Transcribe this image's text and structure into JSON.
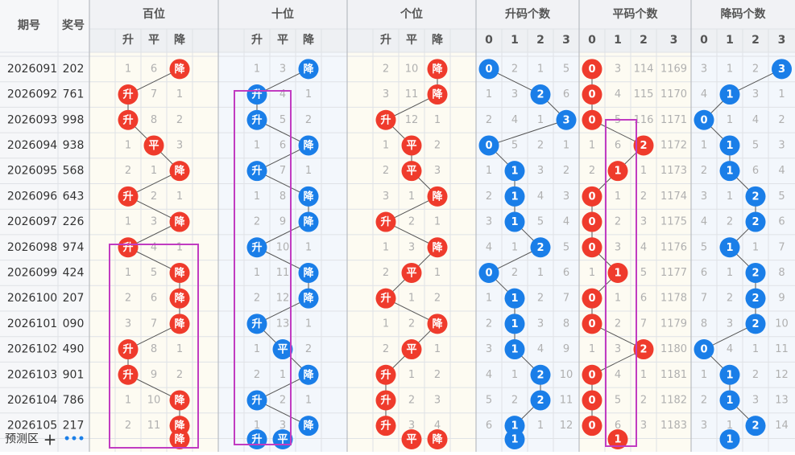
{
  "header": {
    "period_label": "期号",
    "prize_label": "奖号",
    "groups": [
      "百位",
      "十位",
      "个位",
      "升码个数",
      "平码个数",
      "降码个数"
    ],
    "trend_subs": [
      "升",
      "平",
      "降"
    ],
    "count_subs": [
      "0",
      "1",
      "2",
      "3"
    ]
  },
  "footer": {
    "label": "预测区",
    "plus": "+",
    "more": "•••"
  },
  "colors": {
    "red": "#ef3b2c",
    "blue": "#1a7ee8",
    "highlight": "#c13cc1",
    "miss": "#b0b0b0"
  },
  "chart_data": {
    "type": "table",
    "rows": [
      {
        "period": "2026091",
        "number": "202",
        "hundreds": "降",
        "tens": "降",
        "units": "降",
        "up_hit": 0,
        "flat_hit": 0,
        "down_hit": 3,
        "misses": [
          [
            "1",
            "6",
            ""
          ],
          [
            "1",
            "3",
            ""
          ],
          [
            "2",
            "10",
            ""
          ],
          [
            "",
            "2",
            "1",
            "5"
          ],
          [
            "",
            "3",
            "114",
            "1169"
          ],
          [
            "3",
            "1",
            "2",
            ""
          ]
        ]
      },
      {
        "period": "2026092",
        "number": "761",
        "hundreds": "升",
        "tens": "升",
        "units": "降",
        "up_hit": 2,
        "flat_hit": 0,
        "down_hit": 1,
        "misses": [
          [
            "",
            "7",
            "1"
          ],
          [
            "",
            "4",
            "1"
          ],
          [
            "3",
            "11",
            ""
          ],
          [
            "1",
            "3",
            "",
            "6"
          ],
          [
            "",
            "4",
            "115",
            "1170"
          ],
          [
            "4",
            "",
            "3",
            "1"
          ]
        ]
      },
      {
        "period": "2026093",
        "number": "998",
        "hundreds": "升",
        "tens": "升",
        "units": "升",
        "up_hit": 3,
        "flat_hit": 0,
        "down_hit": 0,
        "misses": [
          [
            "",
            "8",
            "2"
          ],
          [
            "",
            "5",
            "2"
          ],
          [
            "",
            "12",
            "1"
          ],
          [
            "2",
            "4",
            "1",
            ""
          ],
          [
            "",
            "5",
            "116",
            "1171"
          ],
          [
            "",
            "1",
            "4",
            "2"
          ]
        ]
      },
      {
        "period": "2026094",
        "number": "938",
        "hundreds": "平",
        "tens": "降",
        "units": "平",
        "up_hit": 0,
        "flat_hit": 2,
        "down_hit": 1,
        "misses": [
          [
            "1",
            "",
            "3"
          ],
          [
            "1",
            "6",
            ""
          ],
          [
            "1",
            "",
            "2"
          ],
          [
            "",
            "5",
            "2",
            "1"
          ],
          [
            "1",
            "6",
            "",
            "1172"
          ],
          [
            "1",
            "",
            "5",
            "3"
          ]
        ]
      },
      {
        "period": "2026095",
        "number": "568",
        "hundreds": "降",
        "tens": "升",
        "units": "平",
        "up_hit": 1,
        "flat_hit": 1,
        "down_hit": 1,
        "misses": [
          [
            "2",
            "1",
            ""
          ],
          [
            "",
            "7",
            "1"
          ],
          [
            "2",
            "",
            "3"
          ],
          [
            "1",
            "",
            "3",
            "2"
          ],
          [
            "2",
            "",
            "1",
            "1173"
          ],
          [
            "2",
            "",
            "6",
            "4"
          ]
        ]
      },
      {
        "period": "2026096",
        "number": "643",
        "hundreds": "升",
        "tens": "降",
        "units": "降",
        "up_hit": 1,
        "flat_hit": 0,
        "down_hit": 2,
        "misses": [
          [
            "",
            "2",
            "1"
          ],
          [
            "1",
            "8",
            ""
          ],
          [
            "3",
            "1",
            ""
          ],
          [
            "2",
            "",
            "4",
            "3"
          ],
          [
            "",
            "1",
            "2",
            "1174"
          ],
          [
            "3",
            "1",
            "",
            "5"
          ]
        ]
      },
      {
        "period": "2026097",
        "number": "226",
        "hundreds": "降",
        "tens": "降",
        "units": "升",
        "up_hit": 1,
        "flat_hit": 0,
        "down_hit": 2,
        "misses": [
          [
            "1",
            "3",
            ""
          ],
          [
            "2",
            "9",
            ""
          ],
          [
            "",
            "2",
            "1"
          ],
          [
            "3",
            "",
            "5",
            "4"
          ],
          [
            "",
            "2",
            "3",
            "1175"
          ],
          [
            "4",
            "2",
            "",
            "6"
          ]
        ]
      },
      {
        "period": "2026098",
        "number": "974",
        "hundreds": "升",
        "tens": "升",
        "units": "降",
        "up_hit": 2,
        "flat_hit": 0,
        "down_hit": 1,
        "misses": [
          [
            "",
            "4",
            "1"
          ],
          [
            "",
            "10",
            "1"
          ],
          [
            "1",
            "3",
            ""
          ],
          [
            "4",
            "1",
            "",
            "5"
          ],
          [
            "",
            "3",
            "4",
            "1176"
          ],
          [
            "5",
            "",
            "1",
            "7"
          ]
        ]
      },
      {
        "period": "2026099",
        "number": "424",
        "hundreds": "降",
        "tens": "降",
        "units": "平",
        "up_hit": 0,
        "flat_hit": 1,
        "down_hit": 2,
        "misses": [
          [
            "1",
            "5",
            ""
          ],
          [
            "1",
            "11",
            ""
          ],
          [
            "2",
            "",
            "1"
          ],
          [
            "",
            "2",
            "1",
            "6"
          ],
          [
            "1",
            "",
            "5",
            "1177"
          ],
          [
            "6",
            "1",
            "",
            "8"
          ]
        ]
      },
      {
        "period": "2026100",
        "number": "207",
        "hundreds": "降",
        "tens": "降",
        "units": "升",
        "up_hit": 1,
        "flat_hit": 0,
        "down_hit": 2,
        "misses": [
          [
            "2",
            "6",
            ""
          ],
          [
            "2",
            "12",
            ""
          ],
          [
            "",
            "1",
            "2"
          ],
          [
            "1",
            "",
            "2",
            "7"
          ],
          [
            "",
            "1",
            "6",
            "1178"
          ],
          [
            "7",
            "2",
            "",
            "9"
          ]
        ]
      },
      {
        "period": "2026101",
        "number": "090",
        "hundreds": "降",
        "tens": "升",
        "units": "降",
        "up_hit": 1,
        "flat_hit": 0,
        "down_hit": 2,
        "misses": [
          [
            "3",
            "7",
            ""
          ],
          [
            "",
            "13",
            "1"
          ],
          [
            "1",
            "2",
            ""
          ],
          [
            "2",
            "",
            "3",
            "8"
          ],
          [
            "",
            "2",
            "7",
            "1179"
          ],
          [
            "8",
            "3",
            "",
            "10"
          ]
        ]
      },
      {
        "period": "2026102",
        "number": "490",
        "hundreds": "升",
        "tens": "平",
        "units": "平",
        "up_hit": 1,
        "flat_hit": 2,
        "down_hit": 0,
        "misses": [
          [
            "",
            "8",
            "1"
          ],
          [
            "1",
            "",
            "2"
          ],
          [
            "2",
            "",
            "1"
          ],
          [
            "3",
            "",
            "4",
            "9"
          ],
          [
            "1",
            "3",
            "",
            "1180"
          ],
          [
            "",
            "4",
            "1",
            "11"
          ]
        ]
      },
      {
        "period": "2026103",
        "number": "901",
        "hundreds": "升",
        "tens": "降",
        "units": "升",
        "up_hit": 2,
        "flat_hit": 0,
        "down_hit": 1,
        "misses": [
          [
            "",
            "9",
            "2"
          ],
          [
            "2",
            "1",
            ""
          ],
          [
            "",
            "1",
            "2"
          ],
          [
            "4",
            "1",
            "",
            "10"
          ],
          [
            "",
            "4",
            "1",
            "1181"
          ],
          [
            "1",
            "",
            "2",
            "12"
          ]
        ]
      },
      {
        "period": "2026104",
        "number": "786",
        "hundreds": "降",
        "tens": "升",
        "units": "升",
        "up_hit": 2,
        "flat_hit": 0,
        "down_hit": 1,
        "misses": [
          [
            "1",
            "10",
            ""
          ],
          [
            "",
            "2",
            "1"
          ],
          [
            "",
            "2",
            "3"
          ],
          [
            "5",
            "2",
            "",
            "11"
          ],
          [
            "",
            "5",
            "2",
            "1182"
          ],
          [
            "2",
            "",
            "3",
            "13"
          ]
        ]
      },
      {
        "period": "2026105",
        "number": "217",
        "hundreds": "降",
        "tens": "降",
        "units": "升",
        "up_hit": 1,
        "flat_hit": 0,
        "down_hit": 2,
        "misses": [
          [
            "2",
            "11",
            ""
          ],
          [
            "1",
            "3",
            ""
          ],
          [
            "",
            "3",
            "4"
          ],
          [
            "6",
            "",
            "1",
            "12"
          ],
          [
            "",
            "6",
            "3",
            "1183"
          ],
          [
            "3",
            "1",
            "",
            "14"
          ]
        ]
      }
    ],
    "prediction": {
      "hundreds": [
        "降"
      ],
      "tens": [
        "升",
        "平"
      ],
      "units": [
        "平",
        "降"
      ],
      "up_hit": [
        1
      ],
      "flat_hit": [
        1
      ],
      "down_hit": [
        1
      ]
    },
    "highlight_boxes": [
      {
        "group": "百位",
        "from_row": "2026099",
        "to_row": "预测区"
      },
      {
        "group": "十位",
        "from_row": "2026093",
        "to_row": "预测区"
      },
      {
        "group": "平码个数",
        "from_row": "2026094",
        "to_row": "预测区"
      }
    ]
  }
}
